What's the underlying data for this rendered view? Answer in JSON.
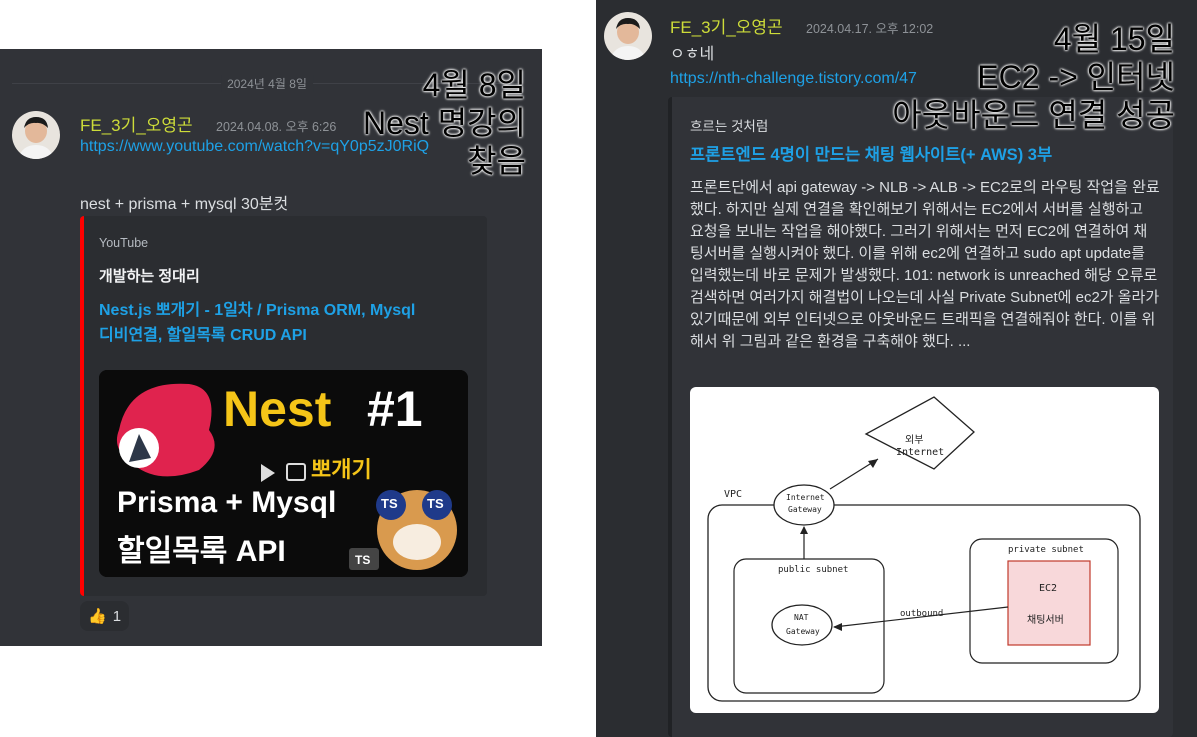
{
  "left": {
    "date_divider": "2024년 4월 8일",
    "username": "FE_3기_오영곤",
    "timestamp": "2024.04.08. 오후 6:26",
    "link": "https://www.youtube.com/watch?v=qY0p5zJ0RiQ",
    "message": "nest + prisma + mysql 30분컷",
    "embed": {
      "accent_color": "#ff0000",
      "provider": "YouTube",
      "author": "개발하는 정대리",
      "title_line1": "Nest.js 뽀개기 - 1일차 / Prisma ORM, Mysql",
      "title_line2": "디비연결, 할일목록 CRUD API",
      "thumbnail": {
        "big_title": "Nest",
        "episode": "#1",
        "subtitle_kr": "뽀개기",
        "line1": "Prisma + Mysql",
        "line2": "할일목록 API",
        "badge1": "TS",
        "badge2": "TS",
        "badge3": "TS"
      }
    },
    "reaction": {
      "emoji": "👍",
      "count": "1"
    }
  },
  "right": {
    "username": "FE_3기_오영곤",
    "timestamp": "2024.04.17. 오후 12:02",
    "message": "ㅇㅎ네",
    "link": "https://nth-challenge.tistory.com/47",
    "embed": {
      "accent_color": "#202225",
      "author": "흐르는 것처럼",
      "title": "프론트엔드 4명이 만드는 채팅 웹사이트(+ AWS) 3부",
      "description": "프론트단에서 api gateway -> NLB -> ALB -> EC2로의 라우팅 작업을 완료했다. 하지만 실제 연결을 확인해보기 위해서는 EC2에서 서버를 실행하고 요청을 보내는 작업을 해야했다. 그러기 위해서는 먼저 EC2에 연결하여 채팅서버를 실행시켜야 했다. 이를 위해 ec2에 연결하고 sudo apt update를 입력했는데 바로 문제가 발생했다. 101: network is unreached 해당 오류로 검색하면 여러가지 해결법이 나오는데 사실 Private Subnet에 ec2가 올라가 있기때문에 외부 인터넷으로 아웃바운드 트래픽을 연결해줘야 한다. 이를 위해서 위 그림과 같은 환경을 구축해야 했다. ...",
      "diagram": {
        "outside": "외부",
        "internet": "Internet",
        "vpc": "VPC",
        "igw_line1": "Internet",
        "igw_line2": "Gateway",
        "public_subnet": "public subnet",
        "private_subnet": "private subnet",
        "nat_line1": "NAT",
        "nat_line2": "Gateway",
        "outbound": "outbound",
        "ec2": "EC2",
        "chat_server": "채팅서버"
      }
    }
  },
  "overlays": {
    "left": [
      "4월 8일",
      "Nest 명강의",
      "찾음"
    ],
    "right": [
      "4월 15일",
      "EC2 -> 인터넷",
      "아웃바운드 연결 성공"
    ]
  }
}
